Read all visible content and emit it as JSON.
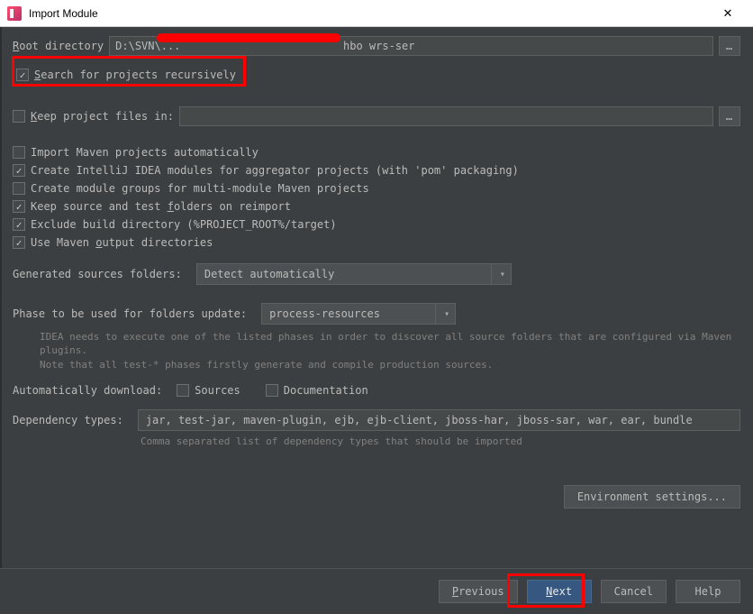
{
  "title": "Import Module",
  "rootDirectory": {
    "label_pre": "R",
    "label_post": "oot directory",
    "value": "D:\\SVN\\...                         hbo wrs-ser"
  },
  "searchRecursively": {
    "checked": true,
    "label_pre": "S",
    "label_post": "earch for projects recursively"
  },
  "keepProjectFiles": {
    "checked": false,
    "label_pre": "K",
    "label_post": "eep project files in:",
    "value": ""
  },
  "options": {
    "importAuto": {
      "checked": false,
      "label": "Import Maven projects automatically"
    },
    "createModules": {
      "checked": true,
      "label": "Create IntelliJ IDEA modules for aggregator projects (with 'pom' packaging)"
    },
    "createGroups": {
      "checked": false,
      "label": "Create module groups for multi-module Maven projects"
    },
    "keepFolders": {
      "checked": true,
      "label_pre": "Keep source and test ",
      "label_u": "f",
      "label_post": "olders on reimport"
    },
    "excludeBuild": {
      "checked": true,
      "label": "Exclude build directory (%PROJECT_ROOT%/target)"
    },
    "useOutput": {
      "checked": true,
      "label_pre": "Use Maven ",
      "label_u": "o",
      "label_post": "utput directories"
    }
  },
  "generatedSources": {
    "label": "Generated sources folders:",
    "value": "Detect automatically"
  },
  "phase": {
    "label": "Phase to be used for folders update:",
    "value": "process-resources",
    "help": "IDEA needs to execute one of the listed phases in order to discover all source folders that are configured via Maven plugins.\nNote that all test-* phases firstly generate and compile production sources."
  },
  "autoDownload": {
    "label": "Automatically download:",
    "sources": {
      "checked": false,
      "label": "Sources"
    },
    "docs": {
      "checked": false,
      "label": "Documentation"
    }
  },
  "dependencyTypes": {
    "label": "Dependency types:",
    "value": "jar, test-jar, maven-plugin, ejb, ejb-client, jboss-har, jboss-sar, war, ear, bundle",
    "help": "Comma separated list of dependency types that should be imported"
  },
  "envSettings": "Environment settings...",
  "buttons": {
    "previous": {
      "label_pre": "P",
      "label_post": "revious"
    },
    "next": {
      "label_pre": "N",
      "label_post": "ext"
    },
    "cancel": "Cancel",
    "help": "Help"
  }
}
